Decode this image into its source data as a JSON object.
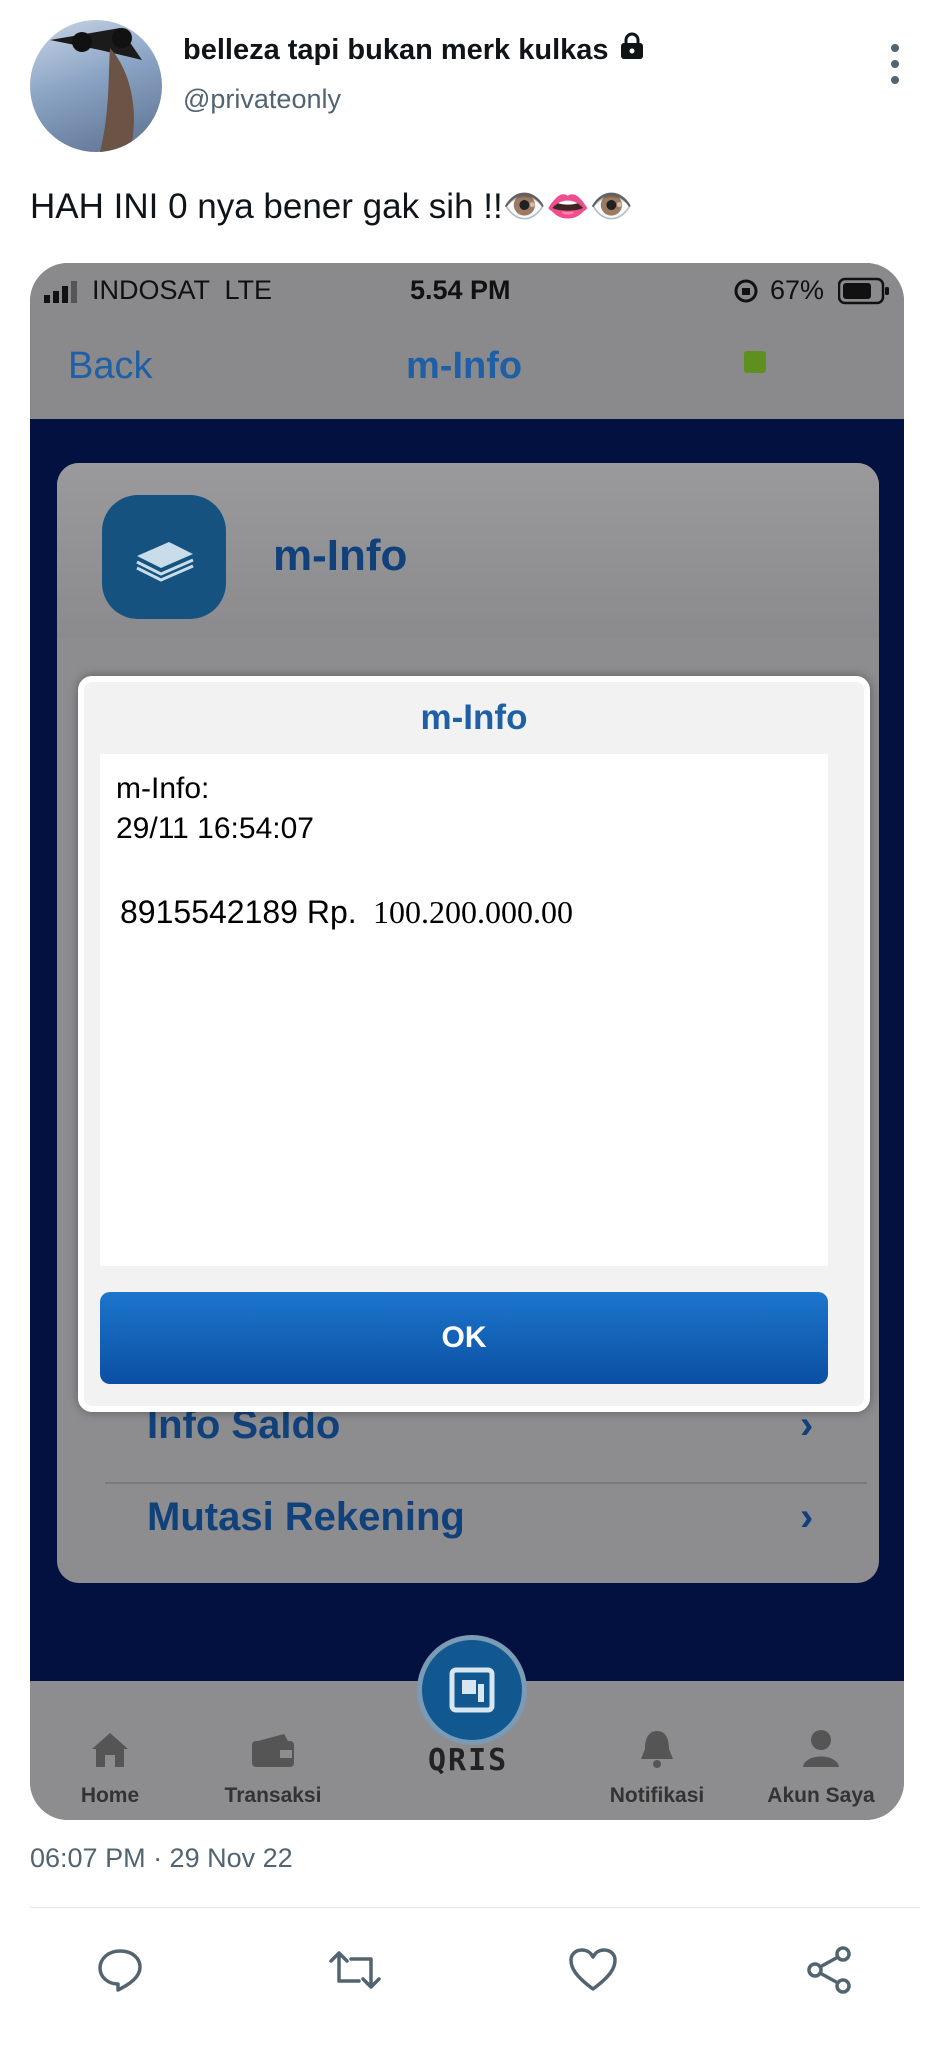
{
  "author": {
    "display_name": "belleza tapi bukan merk kulkas",
    "handle": "@privateonly",
    "lock_icon": "lock-icon"
  },
  "tweet": {
    "text": "HAH INI 0 nya bener gak sih !!👁️👄👁️",
    "timestamp": "06:07 PM · 29 Nov 22"
  },
  "screenshot": {
    "status_bar": {
      "carrier": "INDOSAT  LTE",
      "time": "5.54 PM",
      "battery": "67%"
    },
    "nav": {
      "back_label": "Back",
      "title": "m-Info"
    },
    "card": {
      "title": "m-Info",
      "rows": [
        {
          "label": "Info Saldo"
        },
        {
          "label": "Mutasi Rekening"
        }
      ]
    },
    "dialog": {
      "title": "m-Info",
      "line1": "m-Info:",
      "line2": "29/11 16:54:07",
      "account": "8915542189 Rp.",
      "amount": "100.200.000.00",
      "ok_label": "OK"
    },
    "tabs": [
      {
        "label": "Home",
        "icon": "home-icon"
      },
      {
        "label": "Transaksi",
        "icon": "wallet-icon"
      },
      {
        "label": "Notifikasi",
        "icon": "bell-icon"
      },
      {
        "label": "Akun Saya",
        "icon": "user-icon"
      }
    ],
    "qris_label": "QRIS"
  },
  "colors": {
    "app_blue": "#1f5fa6",
    "dark_navy": "#02113f",
    "muted_text": "#536471"
  }
}
